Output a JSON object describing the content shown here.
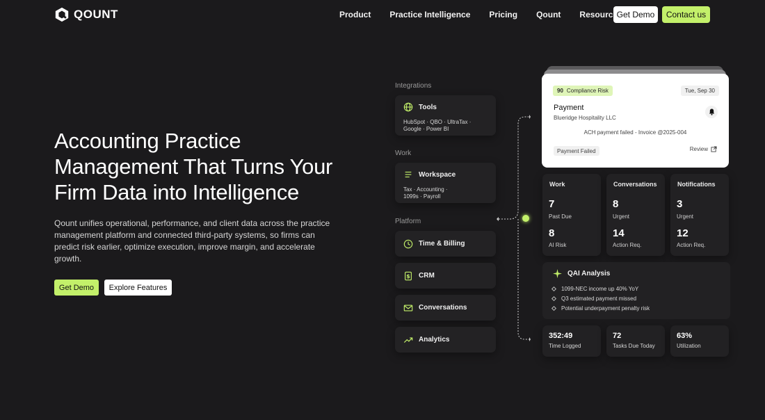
{
  "brand": {
    "name": "QOUNT"
  },
  "nav": {
    "links": [
      "Product",
      "Practice Intelligence",
      "Pricing",
      "Qount",
      "Resources"
    ],
    "get_demo": "Get Demo",
    "contact": "Contact us"
  },
  "hero": {
    "title": "Accounting Practice Management That Turns Your Firm Data into Intelligence",
    "subtitle": "Qount unifies operational, performance, and client data across the practice management platform and connected third-party systems, so firms can predict risk earlier, optimize execution, improve margin, and accelerate growth.",
    "cta_primary": "Get Demo",
    "cta_secondary": "Explore Features"
  },
  "integrations": {
    "label": "Integrations",
    "tools_title": "Tools",
    "tools_desc_1": "HubSpot · QBO · UltraTax ·",
    "tools_desc_2": "Google · Power BI"
  },
  "work": {
    "label": "Work",
    "workspace_title": "Workspace",
    "workspace_desc_1": "Tax · Accounting ·",
    "workspace_desc_2": "1099s · Payroll"
  },
  "platform": {
    "label": "Platform",
    "items": [
      "Time & Billing",
      "CRM",
      "Conversations",
      "Analytics"
    ]
  },
  "payment_card": {
    "score": "90",
    "risk_label": "Compliance Risk",
    "date": "Tue, Sep 30",
    "title": "Payment",
    "client": "Blueridge Hospitality LLC",
    "message": "ACH payment failed - Invoice @2025-004",
    "status": "Payment Failed",
    "review": "Review"
  },
  "stats": {
    "work": {
      "title": "Work",
      "n1": "7",
      "l1": "Past Due",
      "n2": "8",
      "l2": "AI Risk"
    },
    "conversations": {
      "title": "Conversations",
      "n1": "8",
      "l1": "Urgent",
      "n2": "14",
      "l2": "Action Req."
    },
    "notifications": {
      "title": "Notifications",
      "n1": "3",
      "l1": "Urgent",
      "n2": "12",
      "l2": "Action Req."
    }
  },
  "qai": {
    "title": "QAI Analysis",
    "items": [
      "1099-NEC income up 40% YoY",
      "Q3 estimated payment missed",
      "Potential underpayment penalty risk"
    ]
  },
  "bottom_stats": [
    {
      "value": "352:49",
      "label": "Time Logged"
    },
    {
      "value": "72",
      "label": "Tasks Due Today"
    },
    {
      "value": "63%",
      "label": "Utilization"
    }
  ],
  "colors": {
    "accent": "#c3f06a",
    "background": "#1b1a1c",
    "card": "#232224"
  }
}
